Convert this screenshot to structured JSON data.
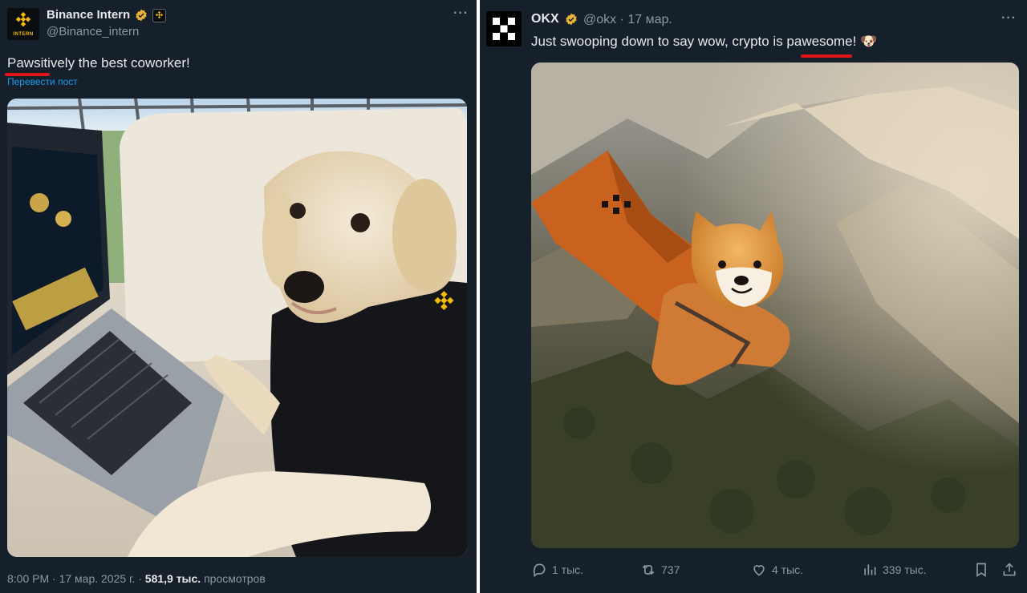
{
  "left_tweet": {
    "display_name": "Binance Intern",
    "handle": "@Binance_intern",
    "avatar_text": "INTERN",
    "text": "Pawsitively the best coworker!",
    "translate_label": "Перевести пост",
    "time": "8:00 PM · 17 мар. 2025 г. · ",
    "views_count": "581,9 тыс.",
    "views_label": " просмотров"
  },
  "right_tweet": {
    "display_name": "OKX",
    "handle_time": "@okx · 17 мар.",
    "text": "Just swooping down to say wow, crypto is pawesome! 🐶",
    "actions": {
      "replies": "1 тыс.",
      "reposts": "737",
      "likes": "4 тыс.",
      "views": "339 тыс."
    }
  },
  "colors": {
    "background": "#15202b",
    "verified_gold": "#e8b23a",
    "binance_yellow": "#f0b90b",
    "link_blue": "#1d9bf0",
    "annotation_red": "#e0161b"
  }
}
